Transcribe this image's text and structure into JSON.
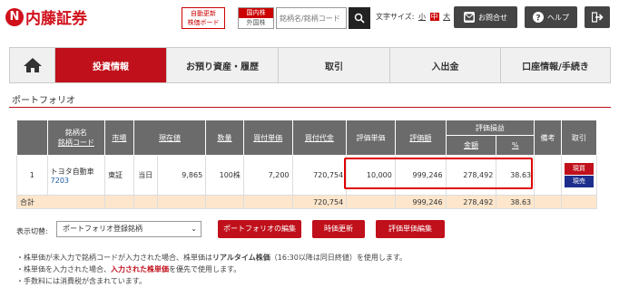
{
  "header": {
    "logo_mark": "N",
    "logo_text": "内藤証券",
    "auto_update_line1": "自動更新",
    "auto_update_line2": "株価ボード",
    "market_domestic": "国内株",
    "market_foreign": "外国株",
    "search_placeholder": "銘柄名/銘柄コード",
    "font_size_label": "文字サイズ:",
    "font_sizes": [
      "小",
      "中",
      "大"
    ],
    "contact_label": "お問合せ",
    "help_label": "ヘルプ"
  },
  "nav": {
    "items": [
      "投資情報",
      "お預り資産・履歴",
      "取引",
      "入出金",
      "口座情報/手続き"
    ]
  },
  "section_title": "ポートフォリオ",
  "table": {
    "headers": {
      "no": "",
      "name": "銘柄名",
      "code": "銘柄コード",
      "market": "市場",
      "price": "現在値",
      "qty": "数量",
      "buy_price": "買付単価",
      "buy_amount": "買付代金",
      "eval_price": "評価単価",
      "eval_amount": "評価額",
      "pl": "評価損益",
      "pl_amount": "金額",
      "pl_pct": "%",
      "note": "備考",
      "trade": "取引"
    },
    "rows": [
      {
        "no": "1",
        "name": "トヨタ自動車",
        "code": "7203",
        "market": "東証",
        "day": "当日",
        "price": "9,865",
        "qty": "100株",
        "buy_price": "7,200",
        "buy_amount": "720,754",
        "eval_price": "10,000",
        "eval_amount": "999,246",
        "pl_amount": "278,492",
        "pl_pct": "38.63",
        "buy_btn": "現買",
        "sell_btn": "現売"
      }
    ],
    "total": {
      "label": "合計",
      "buy_amount": "720,754",
      "eval_amount": "999,246",
      "pl_amount": "278,492",
      "pl_pct": "38.63"
    }
  },
  "controls": {
    "display_label": "表示切替:",
    "display_value": "ポートフォリオ登録銘柄",
    "edit_btn": "ポートフォリオの編集",
    "refresh_btn": "時価更新",
    "eval_edit_btn": "評価単価編集"
  },
  "notes": {
    "line1_a": "・株単価が未入力で銘柄コードが入力された場合、株単価は",
    "line1_b": "リアルタイム株価",
    "line1_c": "（16:30以降は同日終値）を使用します。",
    "line2_a": "・株単価を入力された場合、",
    "line2_b": "入力された株単価",
    "line2_c": "を優先で使用します。",
    "line3": "・手数料には消費税が含まれています。"
  },
  "colors": {
    "brand": "#c0101b",
    "sell": "#1d2e8c",
    "header_gray": "#6b6b6b",
    "total_bg": "#fde6cc"
  }
}
